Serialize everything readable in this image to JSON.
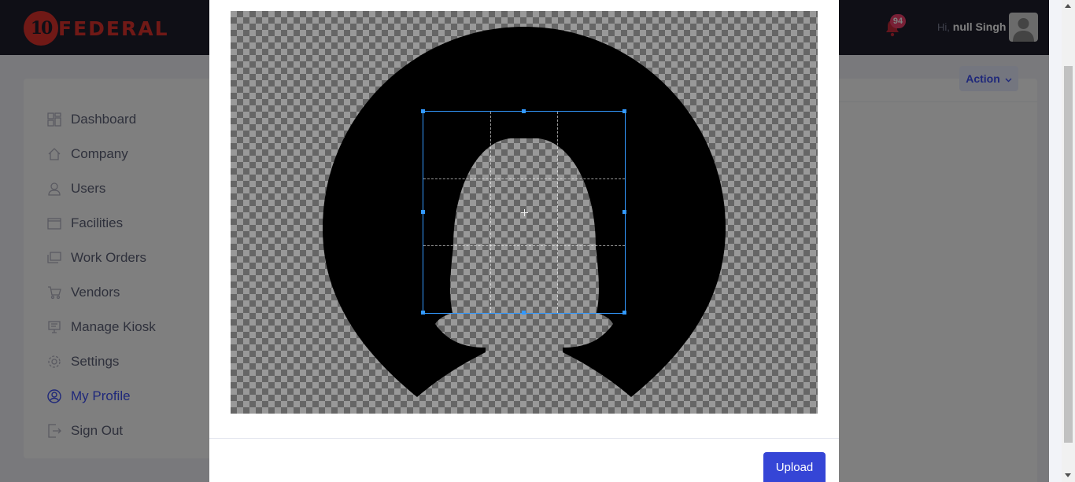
{
  "brand": {
    "logo_number": "10",
    "logo_text": "FEDERAL"
  },
  "header": {
    "notification_count": "94",
    "greeting_prefix": "Hi,",
    "user_name": "null Singh"
  },
  "sidebar": {
    "items": [
      {
        "label": "Dashboard",
        "icon": "dashboard-icon"
      },
      {
        "label": "Company",
        "icon": "home-icon"
      },
      {
        "label": "Users",
        "icon": "users-icon"
      },
      {
        "label": "Facilities",
        "icon": "folder-icon"
      },
      {
        "label": "Work Orders",
        "icon": "work-orders-icon"
      },
      {
        "label": "Vendors",
        "icon": "cart-icon"
      },
      {
        "label": "Manage Kiosk",
        "icon": "kiosk-icon"
      },
      {
        "label": "Settings",
        "icon": "gear-icon"
      },
      {
        "label": "My Profile",
        "icon": "user-circle-icon",
        "active": true
      },
      {
        "label": "Sign Out",
        "icon": "sign-out-icon"
      }
    ]
  },
  "content": {
    "action_label": "Action"
  },
  "modal": {
    "upload_label": "Upload"
  },
  "colors": {
    "topbar": "#1e1e2d",
    "brand_red": "#e0332d",
    "accent": "#3f51f5",
    "badge": "#f1416c",
    "crop_outline": "#3399ff",
    "upload_button": "#3545d6"
  }
}
